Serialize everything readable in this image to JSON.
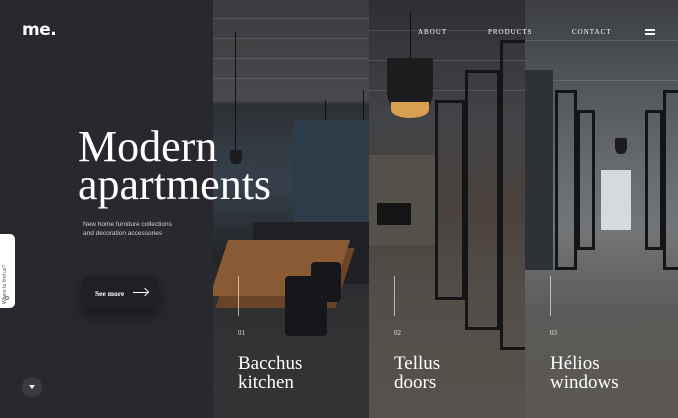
{
  "brand": {
    "logo": "me."
  },
  "nav": {
    "items": [
      "ABOUT",
      "PRODUCTS",
      "CONTACT"
    ],
    "menu_icon": "hamburger-icon"
  },
  "hero": {
    "title_line1": "Modern",
    "title_line2": "apartments",
    "subtitle": "New home furniture collections and decoration accessories",
    "cta_label": "See more",
    "cta_icon": "arrow-right-icon"
  },
  "side_tab": {
    "label": "Where to find us?",
    "icon": "location-icon"
  },
  "scroll": {
    "icon": "chevron-down-icon"
  },
  "panels": [
    {
      "number": "01",
      "line1": "Bacchus",
      "line2": "kitchen"
    },
    {
      "number": "02",
      "line1": "Tellus",
      "line2": "doors"
    },
    {
      "number": "03",
      "line1": "Hélios",
      "line2": "windows"
    }
  ],
  "colors": {
    "background": "#27292e",
    "text": "#ffffff",
    "accent_lamp": "#d79f4e"
  }
}
